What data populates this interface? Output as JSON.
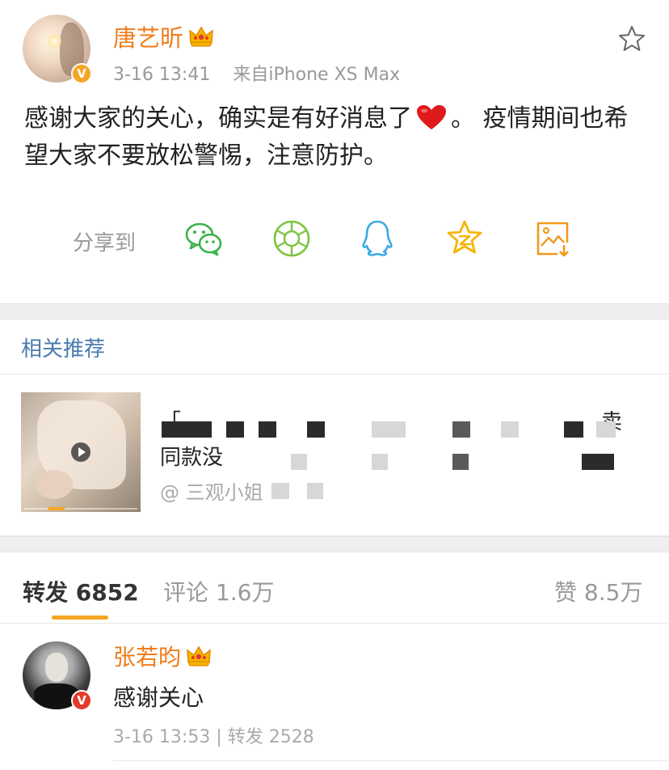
{
  "post": {
    "username": "唐艺昕",
    "time": "3-16 13:41",
    "source": "来自iPhone XS Max",
    "text_part1": "感谢大家的关心，确实是有好消息了",
    "text_part2": "。 疫情期间也希望大家不要放松警惕，注意防护。"
  },
  "share": {
    "label": "分享到",
    "icons": [
      "wechat-icon",
      "moments-icon",
      "qq-icon",
      "qzone-icon",
      "save-image-icon"
    ]
  },
  "related": {
    "header": "相关推荐",
    "line1_visible": "「",
    "line1_end": "卖",
    "line2_visible": "同款没",
    "author": "@ 三观小姐"
  },
  "stats": {
    "repost_label": "转发",
    "repost_count": "6852",
    "comment_label": "评论",
    "comment_count": "1.6万",
    "like_label": "赞",
    "like_count": "8.5万"
  },
  "comment": {
    "username": "张若昀",
    "text": "感谢关心",
    "time": "3-16 13:53",
    "repost": "转发 2528"
  },
  "colors": {
    "username": "#f07c1b",
    "link_blue": "#4a7aae",
    "accent": "#f5a623"
  }
}
